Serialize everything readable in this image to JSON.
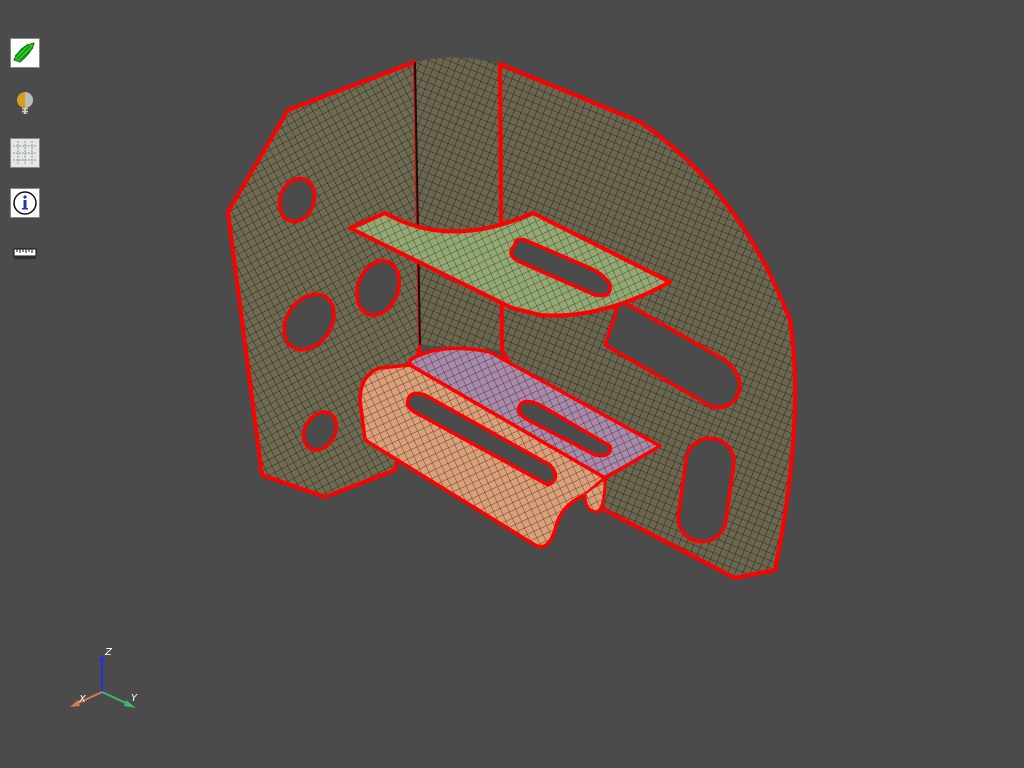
{
  "viewer": {
    "background_color": "#4b4b4b",
    "mesh_edge_color": "#ff0000",
    "mesh_line_color": "#1a1a14"
  },
  "toolbar": {
    "items": [
      {
        "icon": "surface-display-icon",
        "color": "#22cc22"
      },
      {
        "icon": "lighting-icon",
        "color": "#d4a017"
      },
      {
        "icon": "mesh-grid-icon",
        "color": "#cccccc"
      },
      {
        "icon": "info-icon",
        "color": "#1a3aa8"
      },
      {
        "icon": "ruler-icon",
        "color": "#ffffff"
      }
    ]
  },
  "model": {
    "parts": [
      {
        "name": "bracket-wall",
        "color": "#6e6a52"
      },
      {
        "name": "upper-shelf",
        "color": "#93a872"
      },
      {
        "name": "lower-shelf",
        "color": "#a98aa8"
      },
      {
        "name": "lower-flange",
        "color": "#d9a07a"
      }
    ],
    "highlight_edge_color": "#e000e0"
  },
  "triad": {
    "x_label": "X",
    "y_label": "Y",
    "z_label": "Z",
    "x_color": "#e0765a",
    "y_color": "#3fb86a",
    "z_color": "#2233dd"
  }
}
